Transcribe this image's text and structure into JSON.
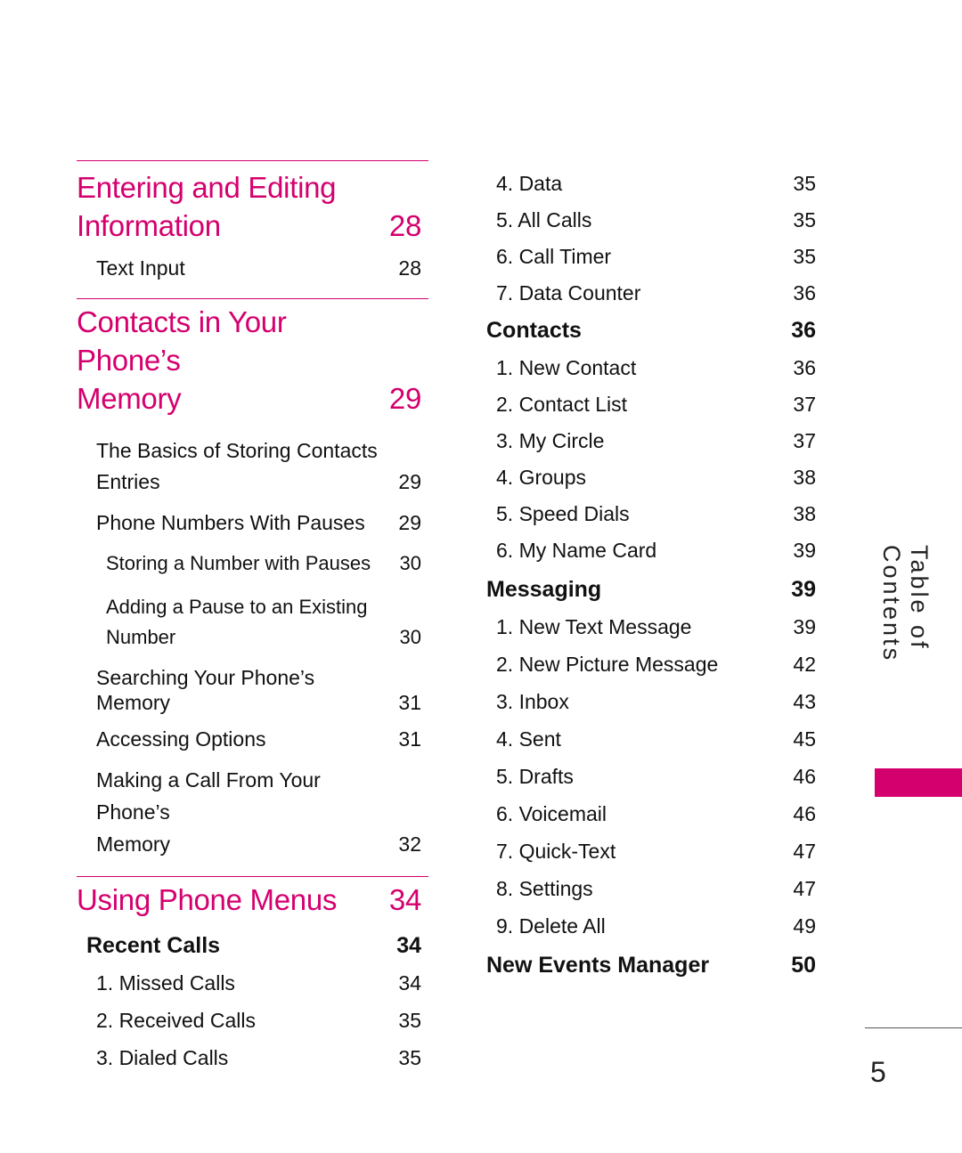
{
  "theme": {
    "accent": "#d4006e"
  },
  "left": {
    "ch1": {
      "title_line1": "Entering and Editing",
      "title_line2": "Information",
      "page": "28",
      "items": [
        {
          "label": "Text Input",
          "page": "28"
        }
      ]
    },
    "ch2": {
      "title_line1": "Contacts in Your Phone’s",
      "title_line2": "Memory",
      "page": "29",
      "items": [
        {
          "label_line1": "The Basics of Storing Contacts",
          "label_line2": "Entries",
          "page": "29"
        },
        {
          "label": "Phone Numbers With Pauses",
          "page": "29"
        },
        {
          "label": "Storing a Number with Pauses",
          "page": "30"
        },
        {
          "label_line1": "Adding a Pause to an Existing",
          "label_line2": "Number",
          "page": "30"
        },
        {
          "label": "Searching Your Phone’s Memory",
          "page": "31"
        },
        {
          "label": "Accessing Options",
          "page": "31"
        },
        {
          "label_line1": "Making a Call From Your Phone’s",
          "label_line2": "Memory",
          "page": "32"
        }
      ]
    },
    "ch3": {
      "title": "Using Phone Menus",
      "page": "34",
      "section": {
        "label": "Recent Calls",
        "page": "34"
      },
      "items": [
        {
          "label": "1. Missed Calls",
          "page": "34"
        },
        {
          "label": "2. Received Calls",
          "page": "35"
        },
        {
          "label": "3. Dialed Calls",
          "page": "35"
        }
      ]
    }
  },
  "right": {
    "recent_calls_cont": [
      {
        "label": "4. Data",
        "page": "35"
      },
      {
        "label": "5. All Calls",
        "page": "35"
      },
      {
        "label": "6. Call Timer",
        "page": "35"
      },
      {
        "label": "7. Data Counter",
        "page": "36"
      }
    ],
    "contacts": {
      "label": "Contacts",
      "page": "36",
      "items": [
        {
          "label": "1. New Contact",
          "page": "36"
        },
        {
          "label": "2. Contact List",
          "page": "37"
        },
        {
          "label": "3. My Circle",
          "page": "37"
        },
        {
          "label": "4. Groups",
          "page": "38"
        },
        {
          "label": "5. Speed Dials",
          "page": "38"
        },
        {
          "label": "6. My Name Card",
          "page": "39"
        }
      ]
    },
    "messaging": {
      "label": "Messaging",
      "page": "39",
      "items": [
        {
          "label": "1. New Text Message",
          "page": "39"
        },
        {
          "label": "2. New Picture Message",
          "page": "42"
        },
        {
          "label": "3. Inbox",
          "page": "43"
        },
        {
          "label": "4. Sent",
          "page": "45"
        },
        {
          "label": "5. Drafts",
          "page": "46"
        },
        {
          "label": "6. Voicemail",
          "page": "46"
        },
        {
          "label": "7. Quick-Text",
          "page": "47"
        },
        {
          "label": "8. Settings",
          "page": "47"
        },
        {
          "label": "9. Delete All",
          "page": "49"
        }
      ]
    },
    "new_events": {
      "label": "New Events Manager",
      "page": "50"
    }
  },
  "side_label": "Table of Contents",
  "page_number": "5"
}
